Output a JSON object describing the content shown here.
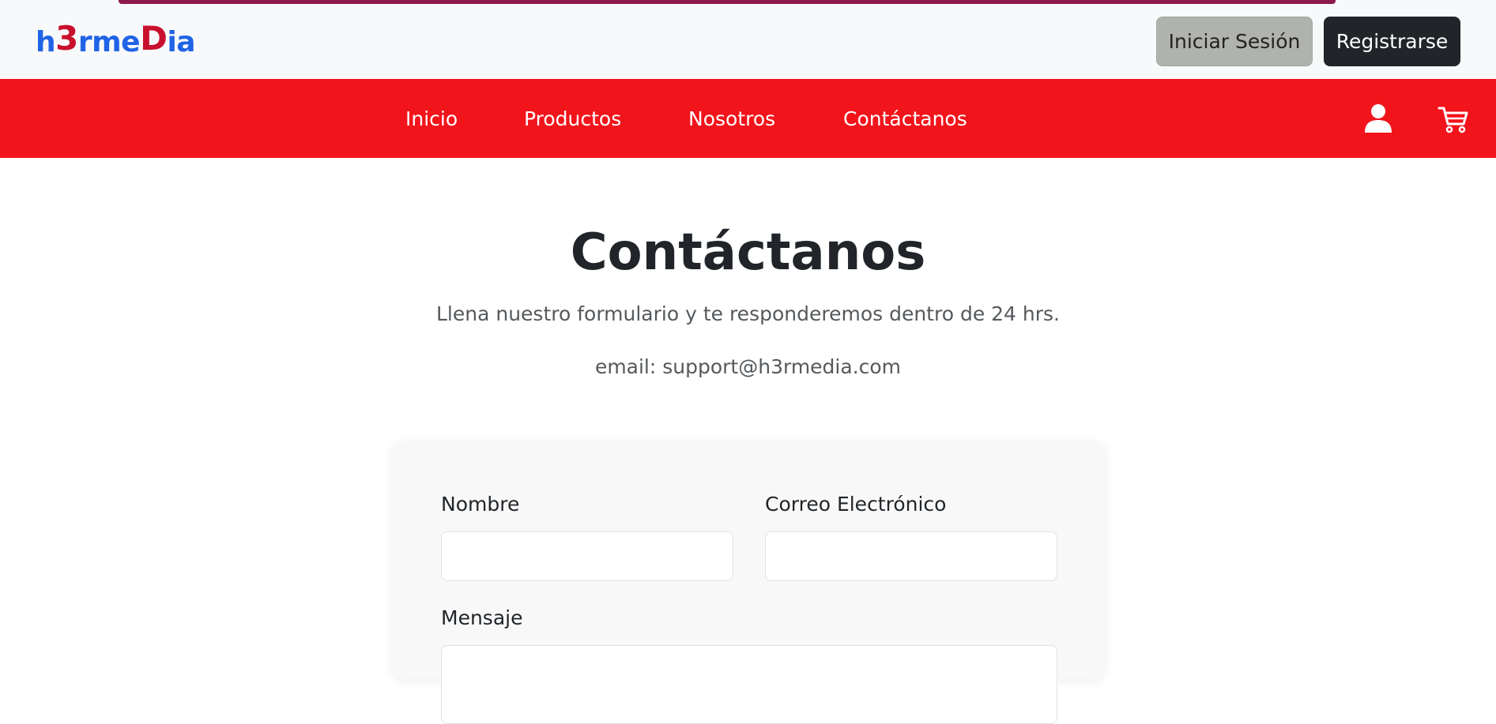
{
  "header": {
    "logo": {
      "part1": "h",
      "part2": "3",
      "part3": "rme",
      "part4": "D",
      "part5": "ia"
    },
    "login_label": "Iniciar Sesión",
    "register_label": "Registrarse"
  },
  "nav": {
    "items": [
      {
        "label": "Inicio"
      },
      {
        "label": "Productos"
      },
      {
        "label": "Nosotros"
      },
      {
        "label": "Contáctanos"
      }
    ],
    "icons": [
      "user-icon",
      "cart-icon"
    ]
  },
  "main": {
    "title": "Contáctanos",
    "subtitle": "Llena nuestro formulario y te responderemos dentro de 24 hrs.",
    "email_line": "email: support@h3rmedia.com"
  },
  "form": {
    "name_label": "Nombre",
    "name_value": "",
    "email_label": "Correo Electrónico",
    "email_value": "",
    "message_label": "Mensaje",
    "message_value": ""
  },
  "colors": {
    "nav_background": "#f2141b",
    "topbar_background": "#f8f9fa",
    "register_button": "#212529",
    "login_button": "#b0b2ad",
    "logo_blue": "#1f63e6",
    "logo_red": "#c8102e"
  }
}
